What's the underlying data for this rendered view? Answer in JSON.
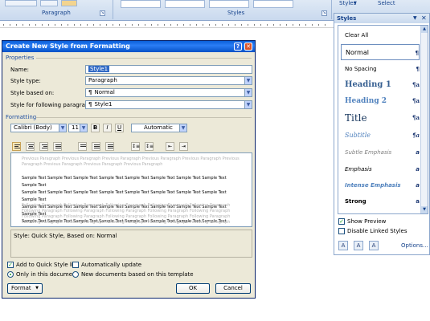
{
  "ribbon": {
    "paragraph_label": "Paragraph",
    "styles_label": "Styles",
    "styles_button": "Styles",
    "select_button": "Select",
    "launcher_glyph": "↘"
  },
  "dialog": {
    "title": "Create New Style from Formatting",
    "help_glyph": "?",
    "close_glyph": "✕",
    "properties_label": "Properties",
    "name_label": "Name:",
    "name_value": "Style1",
    "style_type_label": "Style type:",
    "style_type_value": "Paragraph",
    "based_on_label": "Style based on:",
    "based_on_value": "Normal",
    "following_label": "Style for following paragraph:",
    "following_value": "Style1",
    "formatting_label": "Formatting",
    "font_value": "Calibri (Body)",
    "size_value": "11",
    "bold_glyph": "B",
    "italic_glyph": "I",
    "underline_glyph": "U",
    "color_value": "Automatic",
    "preview": {
      "previous_lines": [
        "Previous Paragraph Previous Paragraph Previous Paragraph Previous Paragraph Previous Paragraph Previous",
        "Paragraph Previous Paragraph Previous Paragraph Previous Paragraph"
      ],
      "sample_lines": [
        "Sample Text Sample Text Sample Text Sample Text Sample Text Sample Text Sample Text Sample Text Sample Text",
        "Sample Text Sample Text Sample Text Sample Text Sample Text Sample Text Sample Text Sample Text Sample Text",
        "Sample Text Sample Text Sample Text Sample Text Sample Text Sample Text Sample Text Sample Text Sample Text",
        "Sample Text Sample Text Sample Text Sample Text Sample Text Sample Text Sample Text Sample Text Sample Text"
      ],
      "following_lines": [
        "Following Paragraph Following Paragraph Following Paragraph Following Paragraph Following Paragraph",
        "Following Paragraph Following Paragraph Following Paragraph Following Paragraph Following Paragraph",
        "Following Paragraph Following Paragraph Following Paragraph Following Paragraph Following Paragraph",
        "Following Paragraph Following Paragraph Following Paragraph Following Paragraph Following Paragraph"
      ]
    },
    "description": "Style: Quick Style, Based on: Normal",
    "add_quick_style": "Add to Quick Style list",
    "auto_update": "Automatically update",
    "only_this_doc": "Only in this document",
    "new_docs": "New documents based on this template",
    "format_button": "Format",
    "ok_button": "OK",
    "cancel_button": "Cancel"
  },
  "styles_pane": {
    "title": "Styles",
    "items": [
      {
        "name": "Clear All",
        "icon": ""
      },
      {
        "name": "Normal",
        "icon": "¶"
      },
      {
        "name": "No Spacing",
        "icon": "¶"
      },
      {
        "name": "Heading 1",
        "icon": "¶a"
      },
      {
        "name": "Heading 2",
        "icon": "¶a"
      },
      {
        "name": "Title",
        "icon": "¶a"
      },
      {
        "name": "Subtitle",
        "icon": "¶a"
      },
      {
        "name": "Subtle Emphasis",
        "icon": "a"
      },
      {
        "name": "Emphasis",
        "icon": "a"
      },
      {
        "name": "Intense Emphasis",
        "icon": "a"
      },
      {
        "name": "Strong",
        "icon": "a"
      }
    ],
    "show_preview": "Show Preview",
    "disable_linked": "Disable Linked Styles",
    "options_link": "Options..."
  },
  "colors": {
    "heading_blue": "#365f91",
    "subtitle_blue": "#4f81bd",
    "title_color": "#17365d"
  }
}
